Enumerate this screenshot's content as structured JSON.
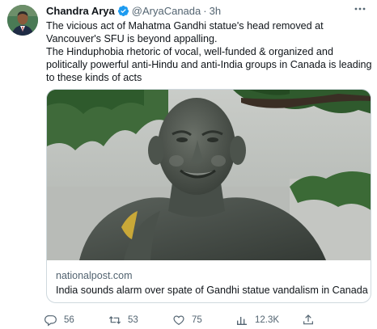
{
  "tweet": {
    "author_name": "Chandra Arya",
    "handle": "@AryaCanada",
    "separator": "·",
    "time": "3h",
    "text_lines": [
      "The vicious act of Mahatma Gandhi statue's head removed at",
      "Vancouver's SFU is beyond appalling.",
      "The Hinduphobia rhetoric of vocal, well-funded & organized and",
      "politically powerful anti-Hindu and anti-India groups in Canada is leading",
      "to these kinds of acts"
    ]
  },
  "card": {
    "domain": "nationalpost.com",
    "title": "India sounds alarm over spate of Gandhi statue vandalism in Canada"
  },
  "actions": {
    "replies": "56",
    "retweets": "53",
    "likes": "75",
    "views": "12.3K"
  },
  "icons": {
    "verified": "verified-badge-icon",
    "more": "more-dots-icon",
    "reply": "reply-icon",
    "retweet": "retweet-icon",
    "like": "heart-icon",
    "views": "views-chart-icon",
    "share": "share-icon"
  },
  "colors": {
    "verified_blue": "#1d9bf0",
    "secondary_text": "#536471",
    "primary_text": "#0f1419",
    "border": "#cfd9de"
  }
}
